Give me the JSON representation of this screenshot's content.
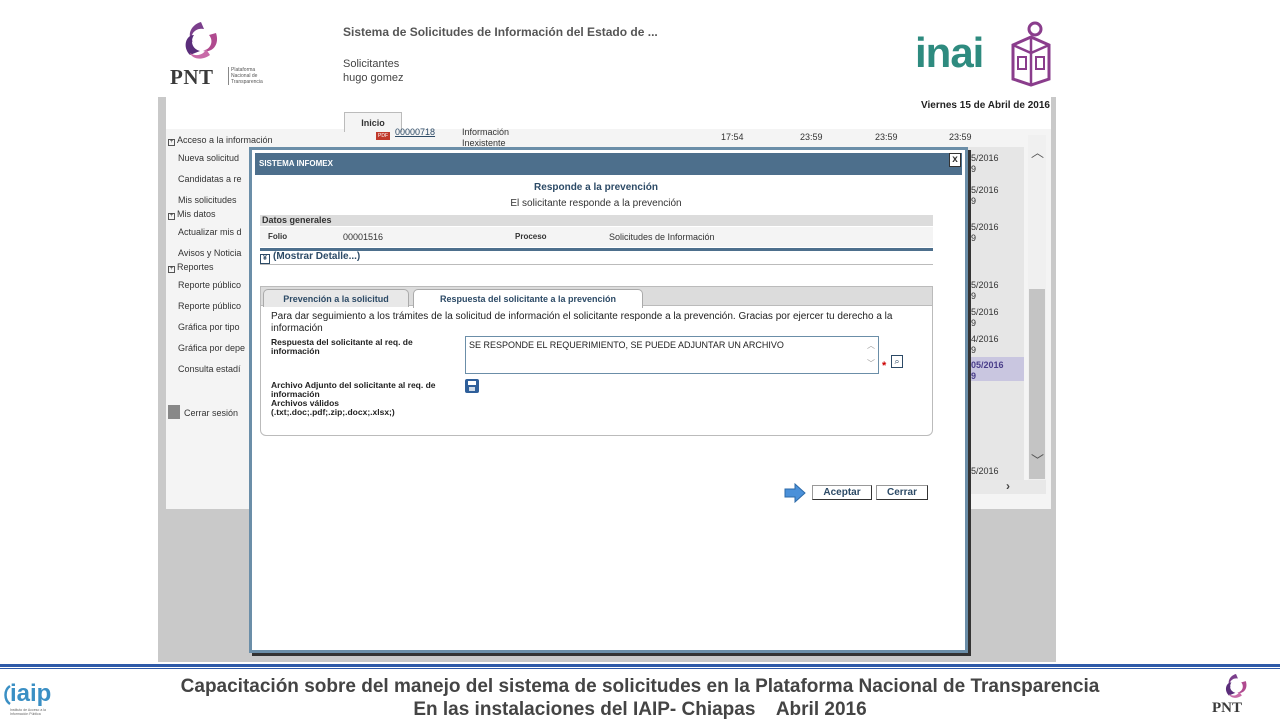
{
  "app": {
    "title": "Sistema de Solicitudes de Información del Estado de ...",
    "section": "Solicitantes",
    "user": "hugo gomez",
    "date": "Viernes 15 de Abril de 2016",
    "pnt_word": "PNT",
    "pnt_sub": "Plataforma Nacional de Transparencia",
    "inai_word": "inai",
    "home_tab": "Inicio"
  },
  "nav": {
    "acceso": "Acceso a la información",
    "nueva": "Nueva solicitud",
    "candidatas": "Candidatas a re",
    "mis_solicitudes": "Mis solicitudes",
    "mis_datos": "Mis datos",
    "actualizar": "Actualizar mis d",
    "avisos": "Avisos y Noticia",
    "reportes": "Reportes",
    "reporte1": "Reporte público",
    "reporte2": "Reporte público",
    "grafica_tipo": "Gráfica por tipo",
    "grafica_dep": "Gráfica por depe",
    "consulta": "Consulta estadí",
    "cerrar": "Cerrar sesión"
  },
  "grid": {
    "row1_folio": "00000718",
    "row1_tipo_a": "Información",
    "row1_tipo_b": "Inexistente",
    "times": [
      "17:54",
      "23:59",
      "23:59",
      "23:59"
    ],
    "right_dates": [
      "5/2016",
      "9",
      "5/2016",
      "9",
      "5/2016",
      "9",
      "5/2016",
      "9",
      "5/2016",
      "9",
      "4/2016",
      "9",
      "05/2016",
      "9",
      "5/2016"
    ]
  },
  "modal": {
    "title": "SISTEMA INFOMEX",
    "close": "x",
    "heading": "Responde a la prevención",
    "subheading": "El solicitante responde a la prevención",
    "datos_generales": "Datos generales",
    "folio_label": "Folio",
    "folio_value": "00001516",
    "proceso_label": "Proceso",
    "proceso_value": "Solicitudes de Información",
    "mostrar": "(Mostrar Detalle...)",
    "tab1": "Prevención a la solicitud",
    "tab2": "Respuesta del solicitante a la prevención",
    "intro": "Para dar seguimiento a los trámites de la solicitud de información el solicitante responde a la prevención. Gracias por ejercer tu derecho a la información",
    "resp_label": "Respuesta del solicitante al req. de información",
    "resp_value": "SE RESPONDE EL REQUERIMIENTO, SE PUEDE ADJUNTAR UN ARCHIVO",
    "required": "*",
    "arch_label": "Archivo Adjunto del solicitante al req. de información",
    "arch_valid": "Archivos válidos",
    "arch_ext": "(.txt;.doc;.pdf;.zip;.docx;.xlsx;)",
    "ok": "Aceptar",
    "cancel": "Cerrar"
  },
  "footer": {
    "line1": "Capacitación sobre del manejo del sistema de solicitudes en la Plataforma Nacional de Transparencia",
    "line2": "En las instalaciones del IAIP- Chiapas    Abril 2016",
    "iaip_word": "iaip",
    "iaip_sub": "Instituto de Acceso a la Información Pública",
    "pnt_word": "PNT"
  },
  "colors": {
    "modal_title_bg": "#4d6f8c",
    "accent_text": "#2c4a66",
    "footer_rule": "#2e5aa8",
    "inai_green": "#2e8b7f"
  }
}
